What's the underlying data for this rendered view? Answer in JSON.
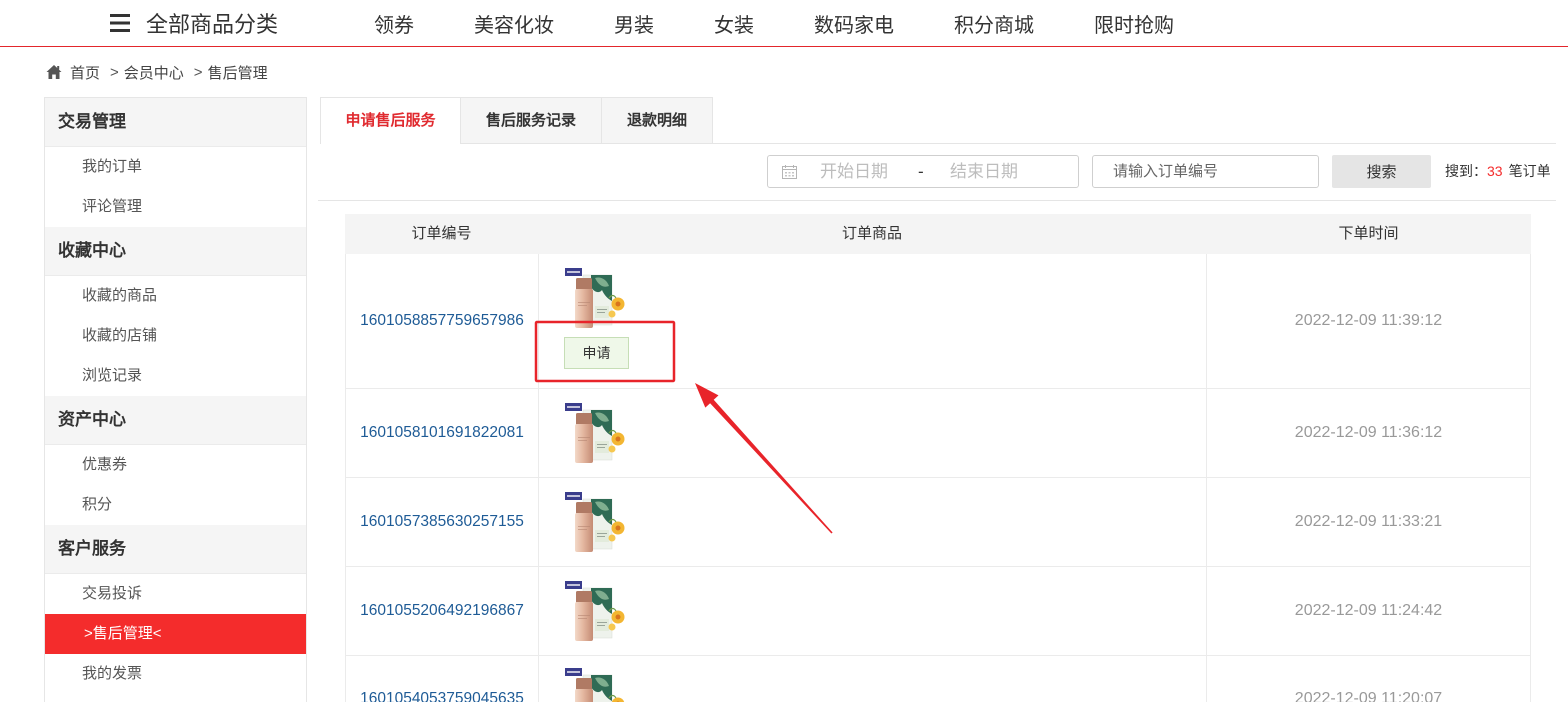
{
  "colors": {
    "accent_red": "#f42c2c",
    "link_blue": "#1e5b96",
    "active_tab_red": "#e02a2f",
    "annotation_red": "#e8242a"
  },
  "topbar": {
    "menu_icon": "menu-icon",
    "category_label": "全部商品分类",
    "nav": [
      "领券",
      "美容化妆",
      "男装",
      "女装",
      "数码家电",
      "积分商城",
      "限时抢购"
    ]
  },
  "breadcrumb": {
    "home_icon": "home-icon",
    "separator": ">",
    "items": [
      "首页",
      "会员中心",
      "售后管理"
    ]
  },
  "sidebar": {
    "sections": [
      {
        "title": "交易管理",
        "items": [
          {
            "label": "我的订单"
          },
          {
            "label": "评论管理"
          }
        ]
      },
      {
        "title": "收藏中心",
        "items": [
          {
            "label": "收藏的商品"
          },
          {
            "label": "收藏的店铺"
          },
          {
            "label": "浏览记录"
          }
        ]
      },
      {
        "title": "资产中心",
        "items": [
          {
            "label": "优惠券"
          },
          {
            "label": "积分"
          }
        ]
      },
      {
        "title": "客户服务",
        "items": [
          {
            "label": "交易投诉"
          },
          {
            "label": ">售后管理<",
            "active": true
          },
          {
            "label": "我的发票"
          }
        ]
      }
    ]
  },
  "tabs": {
    "items": [
      {
        "label": "申请售后服务",
        "active": true
      },
      {
        "label": "售后服务记录"
      },
      {
        "label": "退款明细"
      }
    ]
  },
  "search": {
    "calendar_icon": "calendar-icon",
    "start_date_placeholder": "开始日期",
    "range_separator": "-",
    "end_date_placeholder": "结束日期",
    "order_no_placeholder": "请输入订单编号",
    "button_label": "搜索",
    "result_prefix": "搜到：",
    "result_count": "33",
    "result_suffix": "笔订单"
  },
  "orders_table": {
    "columns": [
      "订单编号",
      "订单商品",
      "下单时间"
    ],
    "product_icon": "product-thumbnail",
    "rows": [
      {
        "order_no": "1601058857759657986",
        "time": "2022-12-09 11:39:12",
        "action_label": "申请"
      },
      {
        "order_no": "1601058101691822081",
        "time": "2022-12-09 11:36:12"
      },
      {
        "order_no": "1601057385630257155",
        "time": "2022-12-09 11:33:21"
      },
      {
        "order_no": "1601055206492196867",
        "time": "2022-12-09 11:24:42"
      },
      {
        "order_no": "1601054053759045635",
        "time": "2022-12-09 11:20:07"
      }
    ]
  }
}
